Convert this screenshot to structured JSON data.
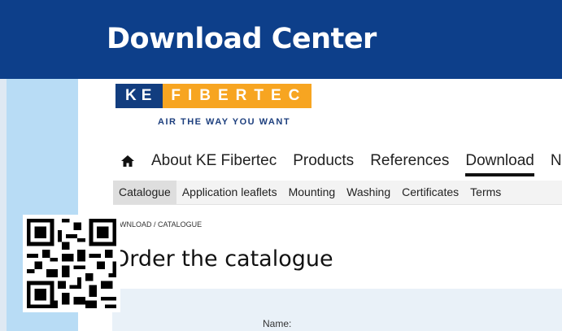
{
  "banner": {
    "title": "Download Center",
    "color": "#0d3f8a"
  },
  "logo": {
    "part1": "KE",
    "part2": "FIBERTEC",
    "colors": {
      "dark": "#123d7f",
      "orange": "#f7a521"
    }
  },
  "tagline": "AIR THE WAY YOU WANT",
  "main_nav": {
    "home_icon": "home-icon",
    "items": [
      "About KE Fibertec",
      "Products",
      "References",
      "Download",
      "N"
    ],
    "active": "Download"
  },
  "sub_nav": {
    "items": [
      "Catalogue",
      "Application leaflets",
      "Mounting",
      "Washing",
      "Certificates",
      "Terms"
    ],
    "active": "Catalogue"
  },
  "breadcrumb": "OWNLOAD / CATALOGUE",
  "page_title": "Order the catalogue",
  "form": {
    "name_label": "Name:"
  },
  "qr_code": "qr-code-icon"
}
